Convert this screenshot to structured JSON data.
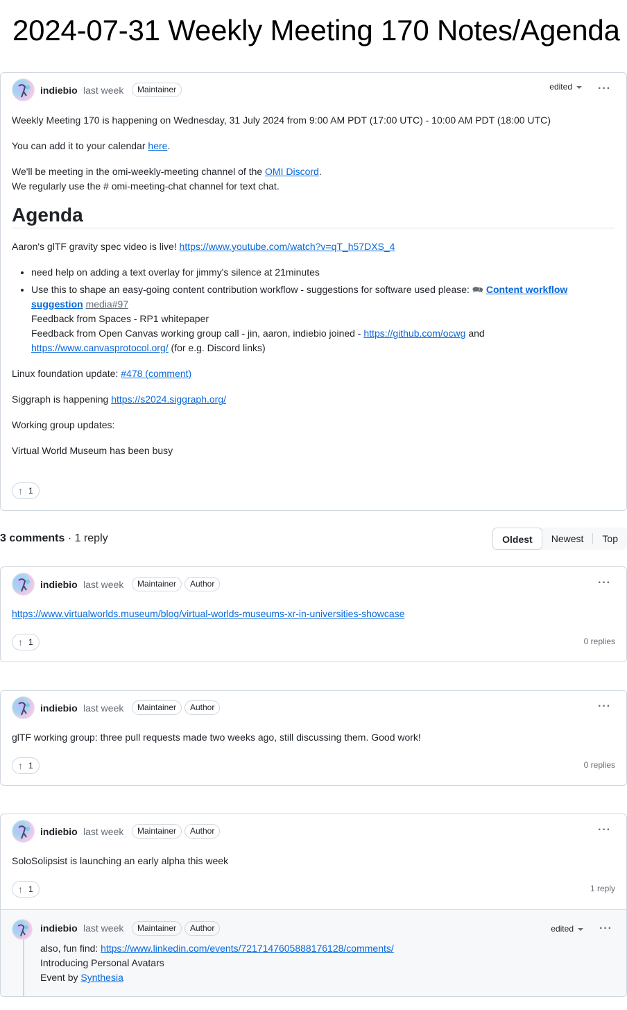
{
  "page": {
    "title": "2024-07-31 Weekly Meeting 170 Notes/Agenda"
  },
  "post": {
    "author": "indiebio",
    "time": "last week",
    "badge": "Maintainer",
    "edited_label": "edited",
    "line1": "Weekly Meeting 170 is happening on Wednesday, 31 July 2024 from 9:00 AM PDT (17:00 UTC) - 10:00 AM PDT (18:00 UTC)",
    "calendar_prefix": "You can add it to your calendar ",
    "calendar_link": "here",
    "calendar_suffix": ".",
    "discord_prefix": "We'll be meeting in the omi-weekly-meeting channel of the ",
    "discord_link": "OMI Discord",
    "discord_suffix": ".",
    "chat_line": "We regularly use the # omi-meeting-chat channel for text chat.",
    "agenda_heading": "Agenda",
    "gltf_prefix": "Aaron's glTF gravity spec video is live! ",
    "gltf_link": "https://www.youtube.com/watch?v=qT_h57DXS_4",
    "bullet1": "need help on adding a text overlay for jimmy's silence at 21minutes",
    "bullet2_prefix": "Use this to shape an easy-going content contribution workflow - suggestions for software used please: ",
    "bullet2_link": "Content workflow suggestion",
    "bullet2_ref": "media#97",
    "bullet2_line2": "Feedback from Spaces - RP1 whitepaper",
    "bullet2_line3_prefix": "Feedback from Open Canvas working group call - jin, aaron, indiebio joined - ",
    "bullet2_link2": "https://github.com/ocwg",
    "bullet2_and": " and",
    "bullet2_link3": "https://www.canvasprotocol.org/",
    "bullet2_suffix": " (for e.g. Discord links)",
    "linux_prefix": "Linux foundation update: ",
    "linux_link": "#478 (comment)",
    "siggraph_prefix": "Siggraph is happening ",
    "siggraph_link": "https://s2024.siggraph.org/",
    "wg_updates": "Working group updates:",
    "vwm": "Virtual World Museum has been busy",
    "upvotes": "1"
  },
  "comments_header": {
    "count": "3 comments",
    "sep": " · ",
    "replies": "1 reply",
    "sort": [
      "Oldest",
      "Newest",
      "Top"
    ]
  },
  "comments": [
    {
      "author": "indiebio",
      "time": "last week",
      "badge1": "Maintainer",
      "badge2": "Author",
      "link": "https://www.virtualworlds.museum/blog/virtual-worlds-museums-xr-in-universities-showcase",
      "upvotes": "1",
      "replies": "0 replies"
    },
    {
      "author": "indiebio",
      "time": "last week",
      "badge1": "Maintainer",
      "badge2": "Author",
      "text": "glTF working group: three pull requests made two weeks ago, still discussing them. Good work!",
      "upvotes": "1",
      "replies": "0 replies"
    },
    {
      "author": "indiebio",
      "time": "last week",
      "badge1": "Maintainer",
      "badge2": "Author",
      "text": "SoloSolipsist is launching an early alpha this week",
      "upvotes": "1",
      "replies": "1 reply",
      "reply": {
        "author": "indiebio",
        "time": "last week",
        "badge1": "Maintainer",
        "badge2": "Author",
        "edited_label": "edited",
        "line1_prefix": "also, fun find: ",
        "line1_link": "https://www.linkedin.com/events/7217147605888176128/comments/",
        "line2": "Introducing Personal Avatars",
        "line3_prefix": "Event by ",
        "line3_link": "Synthesia"
      }
    }
  ]
}
